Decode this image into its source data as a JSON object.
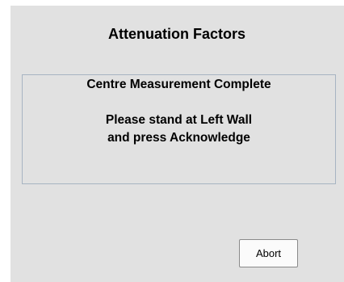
{
  "dialog": {
    "title": "Attenuation Factors",
    "message": {
      "status": "Centre Measurement Complete",
      "instruction_line1": "Please stand at Left Wall",
      "instruction_line2": "and press Acknowledge"
    },
    "abort_label": "Abort"
  },
  "colors": {
    "dialog_background": "#e1e1e1",
    "message_border": "#a7b4c2",
    "button_background": "#fbfbfb"
  }
}
